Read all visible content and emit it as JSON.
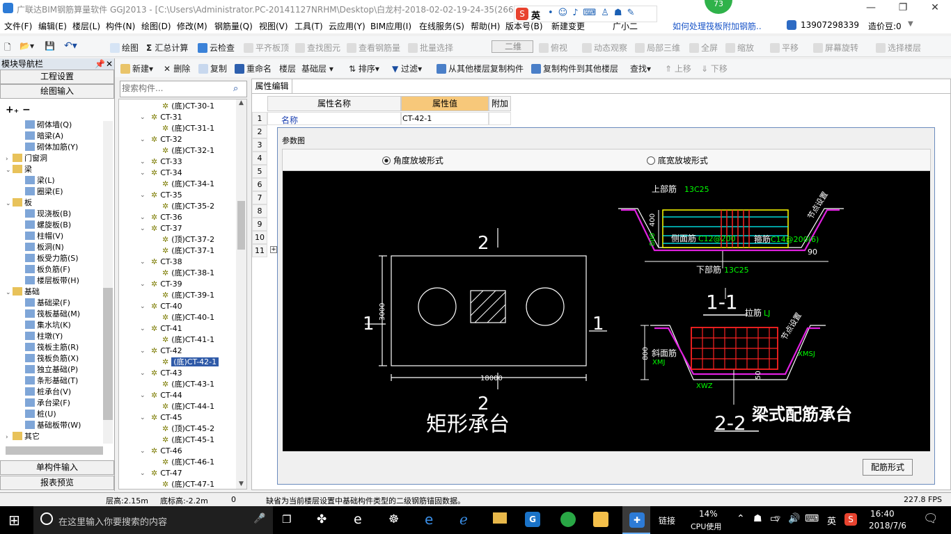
{
  "titlebar": {
    "title": "广联达BIM钢筋算量软件 GGJ2013 - [C:\\Users\\Administrator.PC-20141127NRHM\\Desktop\\白龙村-2018-02-02-19-24-35(2666版).GGJ12]",
    "badge": "73",
    "ime": "英"
  },
  "menu": [
    "文件(F)",
    "编辑(E)",
    "楼层(L)",
    "构件(N)",
    "绘图(D)",
    "修改(M)",
    "钢筋量(Q)",
    "视图(V)",
    "工具(T)",
    "云应用(Y)",
    "BIM应用(I)",
    "在线服务(S)",
    "帮助(H)",
    "版本号(B)",
    "新建变更",
    "广小二"
  ],
  "menu_right": {
    "question": "如何处理筏板附加钢筋..",
    "phone": "13907298339",
    "beans": "造价豆:0"
  },
  "toolbar1": [
    "绘图",
    "汇总计算",
    "云检查",
    "平齐板顶",
    "查找图元",
    "查看钢筋量",
    "批量选择",
    "二维",
    "俯视",
    "动态观察",
    "局部三维",
    "全屏",
    "缩放",
    "平移",
    "屏幕旋转",
    "选择楼层"
  ],
  "toolbar2": [
    "新建",
    "删除",
    "复制",
    "重命名",
    "楼层",
    "基础层",
    "排序",
    "过滤",
    "从其他楼层复制构件",
    "复制构件到其他楼层",
    "查找",
    "上移",
    "下移"
  ],
  "left": {
    "header": "模块导航栏",
    "btn1": "工程设置",
    "btn2": "绘图输入",
    "btn3": "单构件输入",
    "btn4": "报表预览",
    "tree": [
      {
        "t": "砌体墙(Q)",
        "lvl": 2
      },
      {
        "t": "暗梁(A)",
        "lvl": 2
      },
      {
        "t": "砌体加筋(Y)",
        "lvl": 2
      },
      {
        "t": "门窗洞",
        "lvl": 1,
        "tg": ">"
      },
      {
        "t": "梁",
        "lvl": 1,
        "tg": "v"
      },
      {
        "t": "梁(L)",
        "lvl": 2
      },
      {
        "t": "圈梁(E)",
        "lvl": 2
      },
      {
        "t": "板",
        "lvl": 1,
        "tg": "v"
      },
      {
        "t": "现浇板(B)",
        "lvl": 2
      },
      {
        "t": "螺旋板(B)",
        "lvl": 2
      },
      {
        "t": "柱帽(V)",
        "lvl": 2
      },
      {
        "t": "板洞(N)",
        "lvl": 2
      },
      {
        "t": "板受力筋(S)",
        "lvl": 2
      },
      {
        "t": "板负筋(F)",
        "lvl": 2
      },
      {
        "t": "楼层板带(H)",
        "lvl": 2
      },
      {
        "t": "基础",
        "lvl": 1,
        "tg": "v"
      },
      {
        "t": "基础梁(F)",
        "lvl": 2
      },
      {
        "t": "筏板基础(M)",
        "lvl": 2
      },
      {
        "t": "集水坑(K)",
        "lvl": 2
      },
      {
        "t": "柱墩(Y)",
        "lvl": 2
      },
      {
        "t": "筏板主筋(R)",
        "lvl": 2
      },
      {
        "t": "筏板负筋(X)",
        "lvl": 2
      },
      {
        "t": "独立基础(P)",
        "lvl": 2
      },
      {
        "t": "条形基础(T)",
        "lvl": 2
      },
      {
        "t": "桩承台(V)",
        "lvl": 2
      },
      {
        "t": "承台梁(F)",
        "lvl": 2
      },
      {
        "t": "桩(U)",
        "lvl": 2
      },
      {
        "t": "基础板带(W)",
        "lvl": 2
      },
      {
        "t": "其它",
        "lvl": 1,
        "tg": ">"
      }
    ]
  },
  "search_placeholder": "搜索构件...",
  "components": [
    {
      "t": "(底)CT-30-1",
      "lvl": 2
    },
    {
      "t": "CT-31",
      "lvl": 1
    },
    {
      "t": "(底)CT-31-1",
      "lvl": 2
    },
    {
      "t": "CT-32",
      "lvl": 1
    },
    {
      "t": "(底)CT-32-1",
      "lvl": 2
    },
    {
      "t": "CT-33",
      "lvl": 1
    },
    {
      "t": "CT-34",
      "lvl": 1
    },
    {
      "t": "(底)CT-34-1",
      "lvl": 2
    },
    {
      "t": "CT-35",
      "lvl": 1
    },
    {
      "t": "(底)CT-35-2",
      "lvl": 2
    },
    {
      "t": "CT-36",
      "lvl": 1
    },
    {
      "t": "CT-37",
      "lvl": 1
    },
    {
      "t": "(顶)CT-37-2",
      "lvl": 2
    },
    {
      "t": "(底)CT-37-1",
      "lvl": 2
    },
    {
      "t": "CT-38",
      "lvl": 1
    },
    {
      "t": "(底)CT-38-1",
      "lvl": 2
    },
    {
      "t": "CT-39",
      "lvl": 1
    },
    {
      "t": "(底)CT-39-1",
      "lvl": 2
    },
    {
      "t": "CT-40",
      "lvl": 1
    },
    {
      "t": "(底)CT-40-1",
      "lvl": 2
    },
    {
      "t": "CT-41",
      "lvl": 1
    },
    {
      "t": "(底)CT-41-1",
      "lvl": 2
    },
    {
      "t": "CT-42",
      "lvl": 1
    },
    {
      "t": "(底)CT-42-1",
      "lvl": 2,
      "sel": true
    },
    {
      "t": "CT-43",
      "lvl": 1
    },
    {
      "t": "(底)CT-43-1",
      "lvl": 2
    },
    {
      "t": "CT-44",
      "lvl": 1
    },
    {
      "t": "(底)CT-44-1",
      "lvl": 2
    },
    {
      "t": "CT-45",
      "lvl": 1
    },
    {
      "t": "(顶)CT-45-2",
      "lvl": 2
    },
    {
      "t": "(底)CT-45-1",
      "lvl": 2
    },
    {
      "t": "CT-46",
      "lvl": 1
    },
    {
      "t": "(底)CT-46-1",
      "lvl": 2
    },
    {
      "t": "CT-47",
      "lvl": 1
    },
    {
      "t": "(底)CT-47-1",
      "lvl": 2
    }
  ],
  "props": {
    "tab": "属性编辑",
    "col_name": "属性名称",
    "col_value": "属性值",
    "col_extra": "附加",
    "rows": [
      "1",
      "2",
      "3",
      "4",
      "5",
      "6",
      "7",
      "8",
      "9",
      "10",
      "11"
    ],
    "row1_name": "名称",
    "row1_value": "CT-42-1",
    "expand": "+"
  },
  "dialog": {
    "title": "参数图",
    "radio1": "角度放坡形式",
    "radio2": "底宽放坡形式",
    "button": "配筋形式",
    "drawing": {
      "sec_top": "2",
      "sec_bottom": "2",
      "sec_left": "1",
      "sec_right": "1",
      "dim_h": "3000",
      "dim_w": "18000",
      "title_left": "矩形承台",
      "title_right": "梁式配筋承台",
      "s11_top": "上部筋",
      "s11_top_v": "13C25",
      "s11_side": "侧面筋",
      "s11_side_v": "C12@200",
      "s11_stirrup": "箍筋",
      "s11_stirrup_v": "C14@200(6)",
      "s11_bottom": "下部筋",
      "s11_bottom_v": "13C25",
      "s11_h": "400",
      "s11_h2": "800",
      "s11_angle": "90",
      "s11_label": "1-1",
      "node": "节点设置",
      "s22_tie": "拉筋",
      "s22_tie_v": "LJ",
      "s22_side": "斜面筋",
      "s22_xmj": "XMJ",
      "s22_xmsj": "XMSJ",
      "s22_xwz": "XWZ",
      "s22_h": "800",
      "s22_50": "50",
      "s22_label": "2-2"
    }
  },
  "status": {
    "floor_h": "层高:2.15m",
    "bottom_h": "底标高:-2.2m",
    "zero": "0",
    "msg": "缺省为当前楼层设置中基础构件类型的二级钢筋锚固数据。",
    "fps": "227.8 FPS"
  },
  "taskbar": {
    "search": "在这里输入你要搜索的内容",
    "link": "链接",
    "cpu_pct": "14%",
    "cpu_label": "CPU使用",
    "ime": "英",
    "time": "16:40",
    "date": "2018/7/6"
  }
}
